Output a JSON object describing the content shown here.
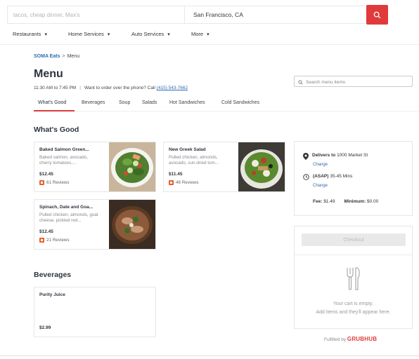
{
  "search": {
    "what_placeholder": "tacos, cheap dinner, Max's",
    "where_value": "San Francisco, CA"
  },
  "catnav": [
    "Restaurants",
    "Home Services",
    "Auto Services",
    "More"
  ],
  "breadcrumb": {
    "home": "SOMA Eats",
    "separator": ">",
    "current": "Menu"
  },
  "page_title": "Menu",
  "hours": {
    "text": "11:30 AM to 7:45 PM",
    "phone_prompt": "Want to order over the phone? Call",
    "phone": "(415) 543-7662"
  },
  "menu_search_placeholder": "Search menu items",
  "tabs": [
    "What's Good",
    "Beverages",
    "Soup",
    "Salads",
    "Hot Sandwiches",
    "Cold Sandwiches"
  ],
  "sections": {
    "whats_good": {
      "title": "What's Good",
      "items": [
        {
          "name": "Baked Salmon Green...",
          "desc": "Baked salmon, avocado, cherry tomatoes,...",
          "price": "$12.45",
          "reviews": "61 Reviews"
        },
        {
          "name": "New Greek Salad",
          "desc": "Pulled chicken, almonds, avocado, sun-dried tom...",
          "price": "$11.45",
          "reviews": "46 Reviews"
        },
        {
          "name": "Spinach, Date and Goa...",
          "desc": "Pulled chicken, almonds, goat cheese, pickled red...",
          "price": "$12.45",
          "reviews": "21 Reviews"
        }
      ]
    },
    "beverages": {
      "title": "Beverages",
      "items": [
        {
          "name": "Purity Juice",
          "price": "$2.99"
        }
      ]
    }
  },
  "delivery": {
    "delivers_to_label": "Delivers to",
    "address": "1000 Market St",
    "change": "Change",
    "asap_label": "(ASAP)",
    "eta": "35-45 Mins",
    "fee_label": "Fee:",
    "fee": "$1.49",
    "minimum_label": "Minimum:",
    "minimum": "$0.00"
  },
  "cart": {
    "checkout": "Checkout",
    "empty_title": "Your cart is empty.",
    "empty_sub": "Add items and they'll appear here."
  },
  "fulfilled": {
    "label": "Fulfilled by",
    "brand": "GRUBHUB"
  },
  "colors": {
    "accent": "#e03a3a",
    "link": "#2b6cb0",
    "review_icon": "#e8602c"
  }
}
